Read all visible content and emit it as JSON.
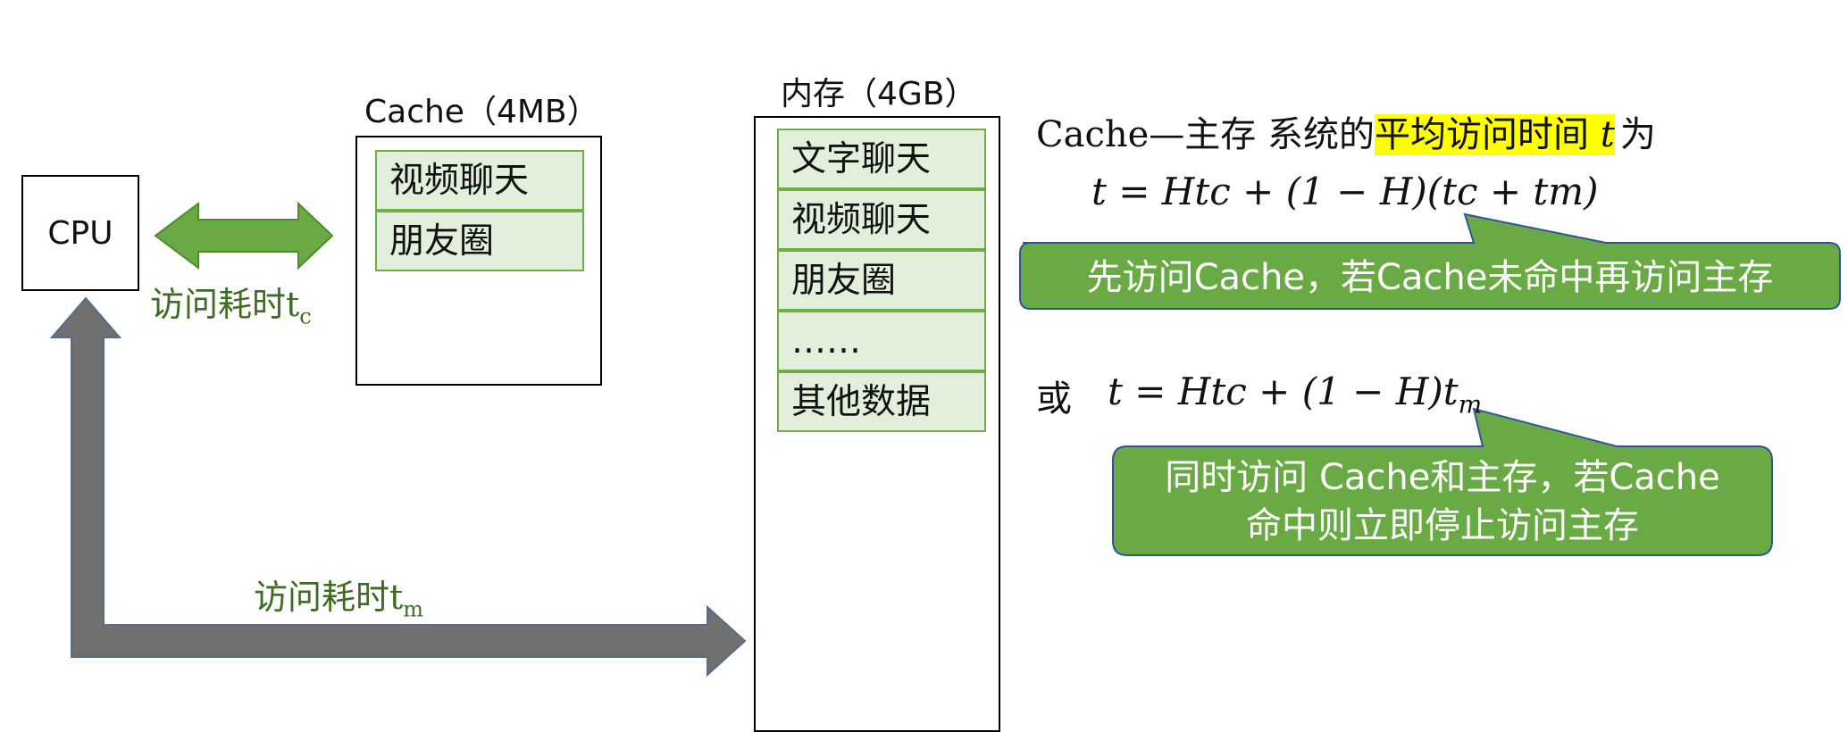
{
  "cpu": {
    "label": "CPU"
  },
  "cache": {
    "title": "Cache（4MB）",
    "rows": [
      "视频聊天",
      "朋友圈"
    ]
  },
  "memory": {
    "title": "内存（4GB）",
    "rows": [
      "文字聊天",
      "视频聊天",
      "朋友圈",
      "……",
      "其他数据"
    ]
  },
  "access_cache": {
    "prefix": "访问耗时",
    "base": "t",
    "sub": "c"
  },
  "access_memory": {
    "prefix": "访问耗时",
    "base": "t",
    "sub": "m"
  },
  "avg_time": {
    "before": "Cache—主存 系统的",
    "highlight": "平均访问时间",
    "var": "t",
    "after": "为"
  },
  "formula1": "t = Htc + (1 − H)(tc + tm)",
  "callout1": "先访问Cache，若Cache未命中再访问主存",
  "or_label": "或",
  "formula2": {
    "main": "t = Htc + (1 − H)t",
    "sub": "m"
  },
  "callout2": {
    "line1": "同时访问 Cache和主存，若Cache",
    "line2": "命中则立即停止访问主存"
  },
  "colors": {
    "green_fill": "#6aaa45",
    "green_stroke": "#4f8a2f",
    "row_fill": "#e2efda",
    "gray_arrow": "#707070",
    "highlight": "#ffff00",
    "callout_stroke": "#2f5597"
  }
}
